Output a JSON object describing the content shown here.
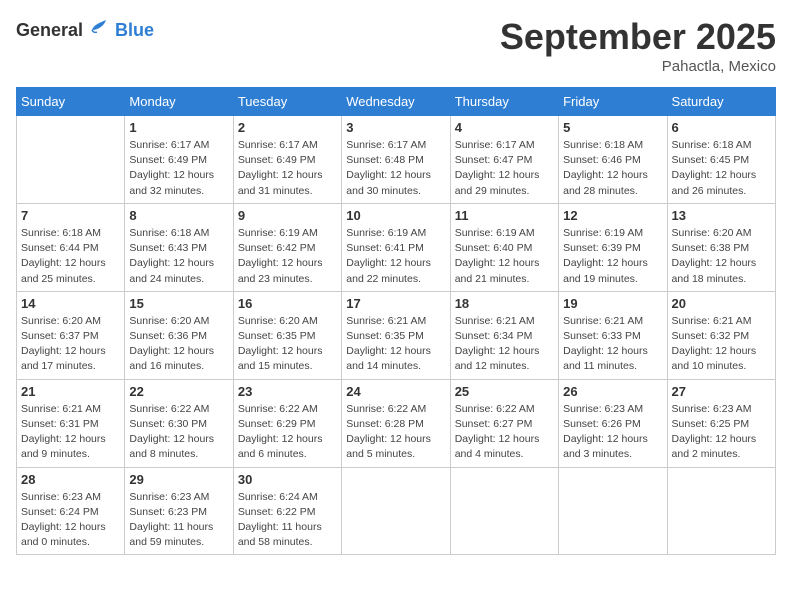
{
  "logo": {
    "general": "General",
    "blue": "Blue"
  },
  "title": "September 2025",
  "location": "Pahactla, Mexico",
  "days_header": [
    "Sunday",
    "Monday",
    "Tuesday",
    "Wednesday",
    "Thursday",
    "Friday",
    "Saturday"
  ],
  "weeks": [
    [
      {
        "day": "",
        "info": ""
      },
      {
        "day": "1",
        "info": "Sunrise: 6:17 AM\nSunset: 6:49 PM\nDaylight: 12 hours\nand 32 minutes."
      },
      {
        "day": "2",
        "info": "Sunrise: 6:17 AM\nSunset: 6:49 PM\nDaylight: 12 hours\nand 31 minutes."
      },
      {
        "day": "3",
        "info": "Sunrise: 6:17 AM\nSunset: 6:48 PM\nDaylight: 12 hours\nand 30 minutes."
      },
      {
        "day": "4",
        "info": "Sunrise: 6:17 AM\nSunset: 6:47 PM\nDaylight: 12 hours\nand 29 minutes."
      },
      {
        "day": "5",
        "info": "Sunrise: 6:18 AM\nSunset: 6:46 PM\nDaylight: 12 hours\nand 28 minutes."
      },
      {
        "day": "6",
        "info": "Sunrise: 6:18 AM\nSunset: 6:45 PM\nDaylight: 12 hours\nand 26 minutes."
      }
    ],
    [
      {
        "day": "7",
        "info": "Sunrise: 6:18 AM\nSunset: 6:44 PM\nDaylight: 12 hours\nand 25 minutes."
      },
      {
        "day": "8",
        "info": "Sunrise: 6:18 AM\nSunset: 6:43 PM\nDaylight: 12 hours\nand 24 minutes."
      },
      {
        "day": "9",
        "info": "Sunrise: 6:19 AM\nSunset: 6:42 PM\nDaylight: 12 hours\nand 23 minutes."
      },
      {
        "day": "10",
        "info": "Sunrise: 6:19 AM\nSunset: 6:41 PM\nDaylight: 12 hours\nand 22 minutes."
      },
      {
        "day": "11",
        "info": "Sunrise: 6:19 AM\nSunset: 6:40 PM\nDaylight: 12 hours\nand 21 minutes."
      },
      {
        "day": "12",
        "info": "Sunrise: 6:19 AM\nSunset: 6:39 PM\nDaylight: 12 hours\nand 19 minutes."
      },
      {
        "day": "13",
        "info": "Sunrise: 6:20 AM\nSunset: 6:38 PM\nDaylight: 12 hours\nand 18 minutes."
      }
    ],
    [
      {
        "day": "14",
        "info": "Sunrise: 6:20 AM\nSunset: 6:37 PM\nDaylight: 12 hours\nand 17 minutes."
      },
      {
        "day": "15",
        "info": "Sunrise: 6:20 AM\nSunset: 6:36 PM\nDaylight: 12 hours\nand 16 minutes."
      },
      {
        "day": "16",
        "info": "Sunrise: 6:20 AM\nSunset: 6:35 PM\nDaylight: 12 hours\nand 15 minutes."
      },
      {
        "day": "17",
        "info": "Sunrise: 6:21 AM\nSunset: 6:35 PM\nDaylight: 12 hours\nand 14 minutes."
      },
      {
        "day": "18",
        "info": "Sunrise: 6:21 AM\nSunset: 6:34 PM\nDaylight: 12 hours\nand 12 minutes."
      },
      {
        "day": "19",
        "info": "Sunrise: 6:21 AM\nSunset: 6:33 PM\nDaylight: 12 hours\nand 11 minutes."
      },
      {
        "day": "20",
        "info": "Sunrise: 6:21 AM\nSunset: 6:32 PM\nDaylight: 12 hours\nand 10 minutes."
      }
    ],
    [
      {
        "day": "21",
        "info": "Sunrise: 6:21 AM\nSunset: 6:31 PM\nDaylight: 12 hours\nand 9 minutes."
      },
      {
        "day": "22",
        "info": "Sunrise: 6:22 AM\nSunset: 6:30 PM\nDaylight: 12 hours\nand 8 minutes."
      },
      {
        "day": "23",
        "info": "Sunrise: 6:22 AM\nSunset: 6:29 PM\nDaylight: 12 hours\nand 6 minutes."
      },
      {
        "day": "24",
        "info": "Sunrise: 6:22 AM\nSunset: 6:28 PM\nDaylight: 12 hours\nand 5 minutes."
      },
      {
        "day": "25",
        "info": "Sunrise: 6:22 AM\nSunset: 6:27 PM\nDaylight: 12 hours\nand 4 minutes."
      },
      {
        "day": "26",
        "info": "Sunrise: 6:23 AM\nSunset: 6:26 PM\nDaylight: 12 hours\nand 3 minutes."
      },
      {
        "day": "27",
        "info": "Sunrise: 6:23 AM\nSunset: 6:25 PM\nDaylight: 12 hours\nand 2 minutes."
      }
    ],
    [
      {
        "day": "28",
        "info": "Sunrise: 6:23 AM\nSunset: 6:24 PM\nDaylight: 12 hours\nand 0 minutes."
      },
      {
        "day": "29",
        "info": "Sunrise: 6:23 AM\nSunset: 6:23 PM\nDaylight: 11 hours\nand 59 minutes."
      },
      {
        "day": "30",
        "info": "Sunrise: 6:24 AM\nSunset: 6:22 PM\nDaylight: 11 hours\nand 58 minutes."
      },
      {
        "day": "",
        "info": ""
      },
      {
        "day": "",
        "info": ""
      },
      {
        "day": "",
        "info": ""
      },
      {
        "day": "",
        "info": ""
      }
    ]
  ]
}
